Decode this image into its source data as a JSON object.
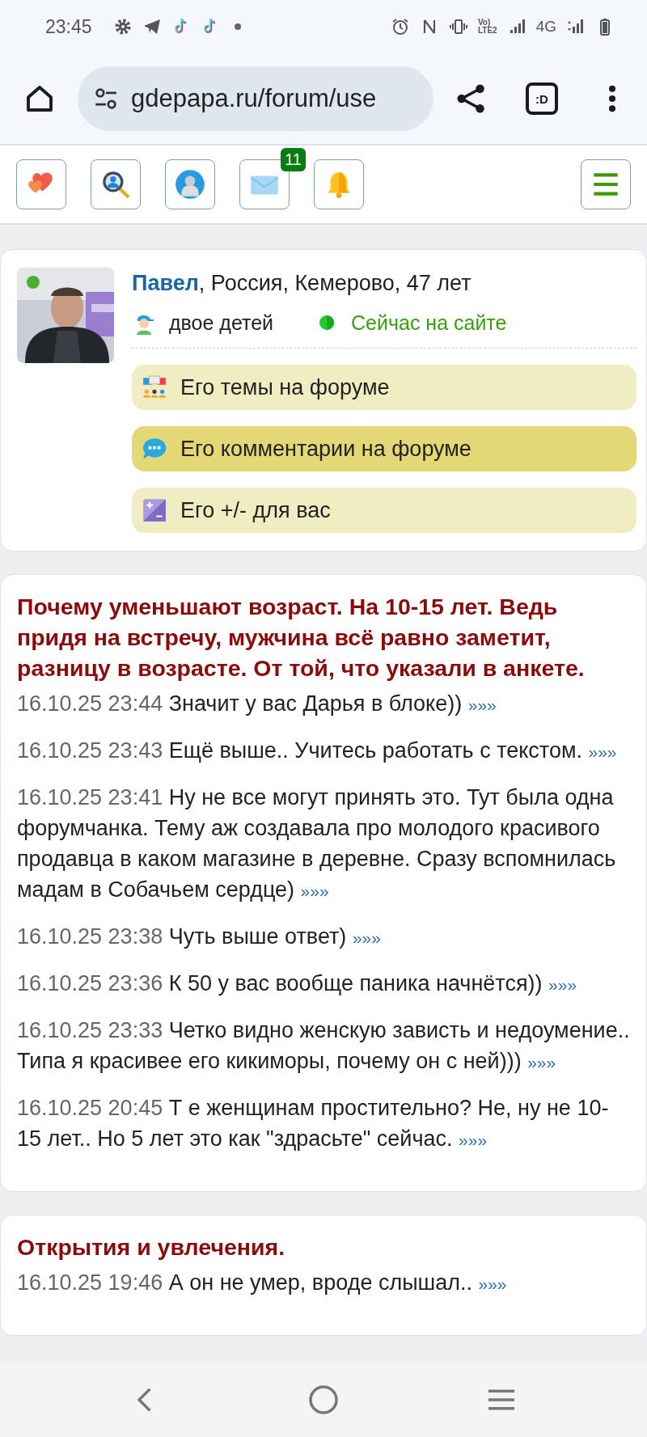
{
  "status_bar": {
    "time": "23:45",
    "volte_top": "Vo)",
    "volte_bottom": "LTE2",
    "network": "4G"
  },
  "browser": {
    "url": "gdepapa.ru/forum/use",
    "tab_label": ":D"
  },
  "nav_icons": [
    {
      "kind": "hearts"
    },
    {
      "kind": "search"
    },
    {
      "kind": "profile"
    },
    {
      "kind": "mail",
      "badge": "11"
    },
    {
      "kind": "bell"
    }
  ],
  "profile": {
    "name": "Павел",
    "details": ", Россия, Кемерово, 47 лет",
    "online": true,
    "children": "двое детей",
    "status": "Сейчас на сайте",
    "links": [
      {
        "kind": "topics",
        "label": "Его темы на форуме",
        "selected": false
      },
      {
        "kind": "comments",
        "label": "Его комментарии на форуме",
        "selected": true
      },
      {
        "kind": "plusminus",
        "label": "Его +/- для вас",
        "selected": false
      }
    ]
  },
  "threads": [
    {
      "title": "Почему уменьшают возраст. На 10-15 лет. Ведь придя на встречу, мужчина всё равно заметит, разницу в возрасте. От той, что указали в анкете.",
      "comments": [
        {
          "time": "16.10.25 23:44",
          "text": "Значит у вас Дарья в блоке))",
          "link": "»»»"
        },
        {
          "time": "16.10.25 23:43",
          "text": "Ещё выше.. Учитесь работать с текстом.",
          "link": "»»»"
        },
        {
          "time": "16.10.25 23:41",
          "text": "Ну не все могут принять это. Тут была одна форумчанка. Тему аж создавала про молодого красивого продавца в каком магазине в деревне. Сразу вспомнилась мадам в Собачьем сердце)",
          "link": "»»»"
        },
        {
          "time": "16.10.25 23:38",
          "text": "Чуть выше ответ)",
          "link": "»»»"
        },
        {
          "time": "16.10.25 23:36",
          "text": "К 50 у вас вообще паника начнётся))",
          "link": "»»»"
        },
        {
          "time": "16.10.25 23:33",
          "text": "Четко видно женскую зависть и недоумение.. Типа я красивее его кикиморы, почему он с ней)))",
          "link": "»»»"
        },
        {
          "time": "16.10.25 20:45",
          "text": "Т е женщинам простительно? Не, ну не 10-15 лет.. Но 5 лет это как \"здрасьте\" сейчас.",
          "link": "»»»"
        }
      ]
    },
    {
      "title": "Открытия и увлечения.",
      "comments": [
        {
          "time": "16.10.25 19:46",
          "text": "А он не умер, вроде слышал..",
          "link": "»»»"
        }
      ]
    }
  ]
}
